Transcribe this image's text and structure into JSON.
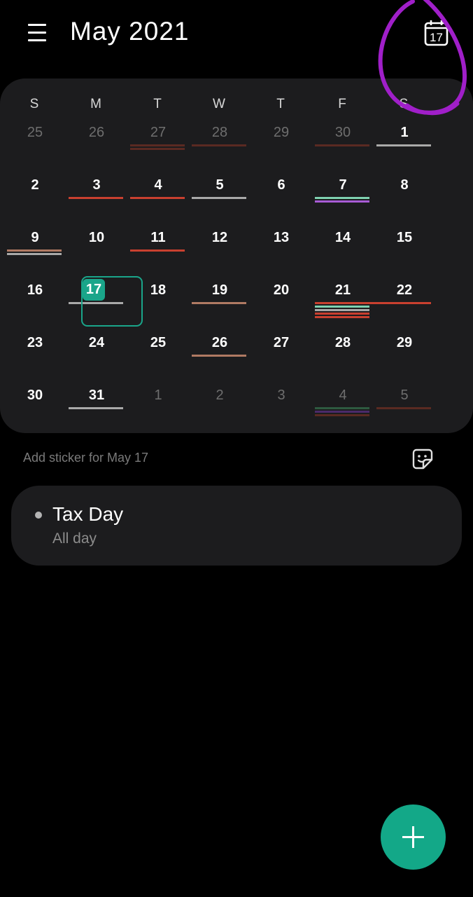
{
  "header": {
    "title": "May 2021",
    "today_icon_label": "17"
  },
  "weekdays": [
    "S",
    "M",
    "T",
    "W",
    "T",
    "F",
    "S"
  ],
  "selected_day": "17",
  "grid": [
    [
      {
        "d": "25",
        "m": true,
        "bars": []
      },
      {
        "d": "26",
        "m": true,
        "bars": []
      },
      {
        "d": "27",
        "m": true,
        "bars": [
          "#5a2a22",
          "#5a2a22"
        ]
      },
      {
        "d": "28",
        "m": true,
        "bars": [
          "#5a2a22"
        ]
      },
      {
        "d": "29",
        "m": true,
        "bars": []
      },
      {
        "d": "30",
        "m": true,
        "bars": [
          "#5a2a22"
        ]
      },
      {
        "d": "1",
        "m": false,
        "bars": [
          "#a9a9a9"
        ]
      }
    ],
    [
      {
        "d": "2",
        "m": false,
        "bars": []
      },
      {
        "d": "3",
        "m": false,
        "bars": [
          "#c9402f"
        ]
      },
      {
        "d": "4",
        "m": false,
        "bars": [
          "#c9402f"
        ]
      },
      {
        "d": "5",
        "m": false,
        "bars": [
          "#a9a9a9"
        ]
      },
      {
        "d": "6",
        "m": false,
        "bars": []
      },
      {
        "d": "7",
        "m": false,
        "bars": [
          "#7fd1b0",
          "#a85cd6"
        ]
      },
      {
        "d": "8",
        "m": false,
        "bars": []
      }
    ],
    [
      {
        "d": "9",
        "m": false,
        "bars": [
          "#b07a63",
          "#a9a9a9"
        ]
      },
      {
        "d": "10",
        "m": false,
        "bars": []
      },
      {
        "d": "11",
        "m": false,
        "bars": [
          "#c9402f"
        ]
      },
      {
        "d": "12",
        "m": false,
        "bars": []
      },
      {
        "d": "13",
        "m": false,
        "bars": []
      },
      {
        "d": "14",
        "m": false,
        "bars": []
      },
      {
        "d": "15",
        "m": false,
        "bars": []
      }
    ],
    [
      {
        "d": "16",
        "m": false,
        "bars": []
      },
      {
        "d": "17",
        "m": false,
        "bars": [
          "#a9a9a9"
        ]
      },
      {
        "d": "18",
        "m": false,
        "bars": []
      },
      {
        "d": "19",
        "m": false,
        "bars": [
          "#b07a63"
        ]
      },
      {
        "d": "20",
        "m": false,
        "bars": []
      },
      {
        "d": "21",
        "m": false,
        "bars": [
          "#c9402f",
          "#7fd1b0",
          "#a9a9a9",
          "#c9402f",
          "#c9402f"
        ]
      },
      {
        "d": "22",
        "m": false,
        "bars": [
          "#c9402f"
        ]
      }
    ],
    [
      {
        "d": "23",
        "m": false,
        "bars": []
      },
      {
        "d": "24",
        "m": false,
        "bars": []
      },
      {
        "d": "25",
        "m": false,
        "bars": []
      },
      {
        "d": "26",
        "m": false,
        "bars": [
          "#b07a63"
        ]
      },
      {
        "d": "27",
        "m": false,
        "bars": []
      },
      {
        "d": "28",
        "m": false,
        "bars": []
      },
      {
        "d": "29",
        "m": false,
        "bars": []
      }
    ],
    [
      {
        "d": "30",
        "m": false,
        "bars": []
      },
      {
        "d": "31",
        "m": false,
        "bars": [
          "#a9a9a9"
        ]
      },
      {
        "d": "1",
        "m": true,
        "bars": []
      },
      {
        "d": "2",
        "m": true,
        "bars": []
      },
      {
        "d": "3",
        "m": true,
        "bars": []
      },
      {
        "d": "4",
        "m": true,
        "bars": [
          "#2e5a40",
          "#4a2a6a",
          "#5a2a22"
        ]
      },
      {
        "d": "5",
        "m": true,
        "bars": [
          "#5a2a22"
        ]
      }
    ]
  ],
  "sticker_hint": "Add sticker for May 17",
  "event": {
    "title": "Tax Day",
    "subtitle": "All day"
  },
  "colors": {
    "accent": "#13a888",
    "background": "#000000",
    "card": "#1c1c1e",
    "annotation": "#a01fc9"
  },
  "icons": [
    "menu-icon",
    "calendar-today-icon",
    "sticker-icon",
    "plus-icon"
  ]
}
